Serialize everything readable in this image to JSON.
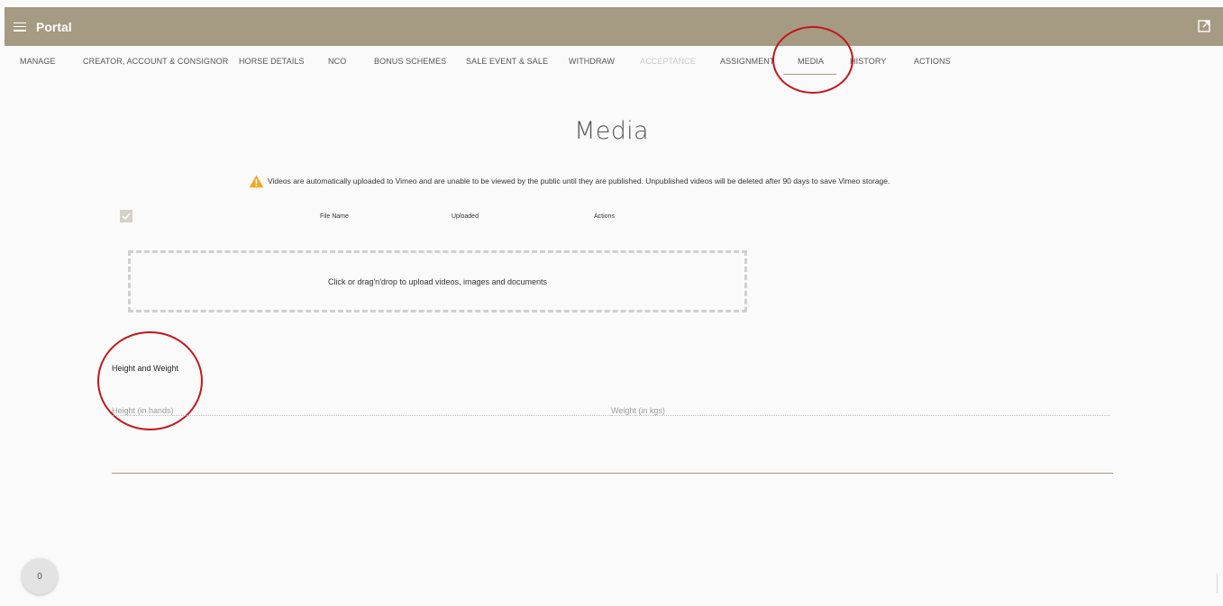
{
  "header": {
    "app_title": "Portal",
    "menu_icon": "hamburger-menu-icon",
    "external_icon": "open-in-new-icon",
    "color": "#a59a82"
  },
  "tabs": [
    {
      "label": "MANAGE"
    },
    {
      "label": "CREATOR, ACCOUNT & CONSIGNOR"
    },
    {
      "label": "HORSE DETAILS"
    },
    {
      "label": "NCO"
    },
    {
      "label": "BONUS SCHEMES"
    },
    {
      "label": "SALE EVENT & SALE"
    },
    {
      "label": "WITHDRAW"
    },
    {
      "label": "ACCEPTANCE",
      "disabled": true
    },
    {
      "label": "ASSIGNMENT"
    },
    {
      "label": "MEDIA",
      "active": true
    },
    {
      "label": "HISTORY"
    },
    {
      "label": "ACTIONS"
    }
  ],
  "page": {
    "title": "Media",
    "notice": "Videos are automatically uploaded to Vimeo and are unable to be viewed by the public until they are published. Unpublished videos will be deleted after 90 days to save Vimeo storage.",
    "notice_icon": "warning-icon",
    "warning_color": "#f5a623"
  },
  "table": {
    "columns": [
      "File Name",
      "Uploaded",
      "Actions"
    ]
  },
  "dropzone": {
    "label": "Click or drag'n'drop to upload videos, images and documents"
  },
  "measurements": {
    "title": "Height and Weight",
    "height_placeholder": "Height (in hands)",
    "weight_placeholder": "Weight (in kgs)"
  },
  "fab": {
    "count": "0"
  },
  "annotation_color": "#c4151c"
}
